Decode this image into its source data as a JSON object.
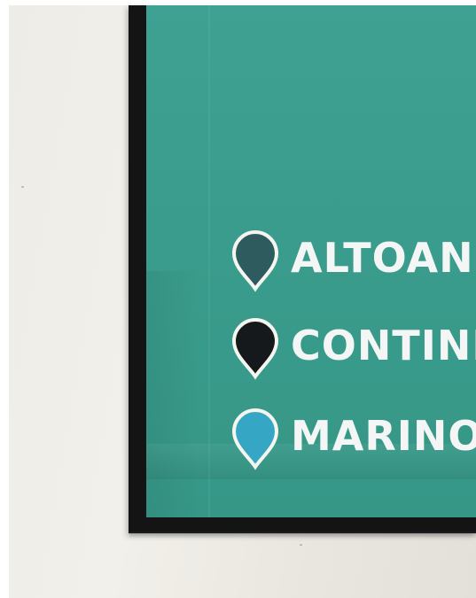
{
  "legend": {
    "items": [
      {
        "label": "ALTOAN",
        "pin_color": "#2e5c5e",
        "icon": "map-pin-icon"
      },
      {
        "label": "CONTINI",
        "pin_color": "#15191b",
        "icon": "map-pin-icon"
      },
      {
        "label": "MARINO",
        "pin_color": "#35a6c4",
        "icon": "map-pin-icon"
      }
    ]
  },
  "colors": {
    "poster": "#3a9c8c",
    "frame": "#141414",
    "wall": "#efede7",
    "label_text": "#f3f6f5",
    "pin_outline": "#f5f5f0"
  }
}
